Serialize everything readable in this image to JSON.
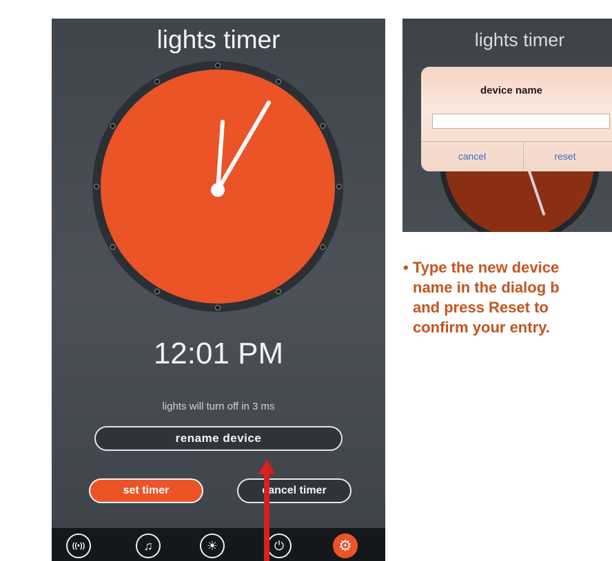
{
  "main_screen": {
    "title": "lights timer",
    "time": "12:01 PM",
    "status": "lights will turn off in 3 ms",
    "rename_button": "rename device",
    "set_timer_button": "set timer",
    "cancel_timer_button": "cancel timer",
    "tabs": [
      {
        "icon": "wireless-icon",
        "glyph": "((•))"
      },
      {
        "icon": "music-note-icon",
        "glyph": "♫"
      },
      {
        "icon": "lightbulb-icon",
        "glyph": "☀"
      },
      {
        "icon": "power-icon",
        "glyph": "⏻"
      },
      {
        "icon": "gear-icon",
        "glyph": "⚙"
      }
    ],
    "active_tab": "gear-icon"
  },
  "dialog_screen": {
    "title": "lights timer",
    "dialog_title": "device name",
    "input_value": "",
    "cancel_button": "cancel",
    "reset_button": "reset"
  },
  "caption": {
    "bullet": "•",
    "lines": [
      "Type the new device",
      "name in the dialog b",
      "and press Reset to",
      "confirm your entry."
    ]
  },
  "colors": {
    "accent": "#ea5426",
    "background": "#454a52",
    "annotation_arrow": "#d9201f",
    "caption_text": "#c5541f",
    "dialog_link": "#3c6ec8"
  }
}
